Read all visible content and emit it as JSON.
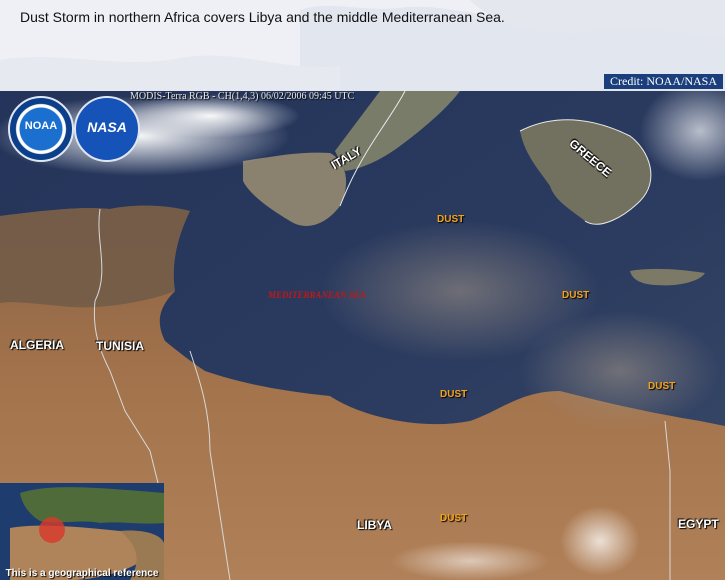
{
  "header": {
    "title": "Dust Storm in northern Africa covers Libya and the middle Mediterranean Sea.",
    "credit": "Credit: NOAA/NASA"
  },
  "image": {
    "caption": "MODIS-Terra RGB - CH(1,4,3) 06/02/2006 09:45 UTC",
    "logos": {
      "noaa": "NOAA",
      "nasa": "NASA"
    },
    "labels": {
      "italy": "ITALY",
      "greece": "GREECE",
      "algeria": "ALGERIA",
      "tunisia": "TUNISIA",
      "libya": "LIBYA",
      "egypt": "EGYPT",
      "sea": "MEDITERRANEAN SEA",
      "dust": "DUST"
    }
  },
  "inset": {
    "caption": "This is a geographical reference"
  },
  "colors": {
    "sea": "#2a3a5e",
    "land": "#a06e46",
    "header_bg": "#eef0f5",
    "credit_bg": "#1b3f7d",
    "dust_label": "#f5a21a",
    "sea_label": "#c01818"
  }
}
